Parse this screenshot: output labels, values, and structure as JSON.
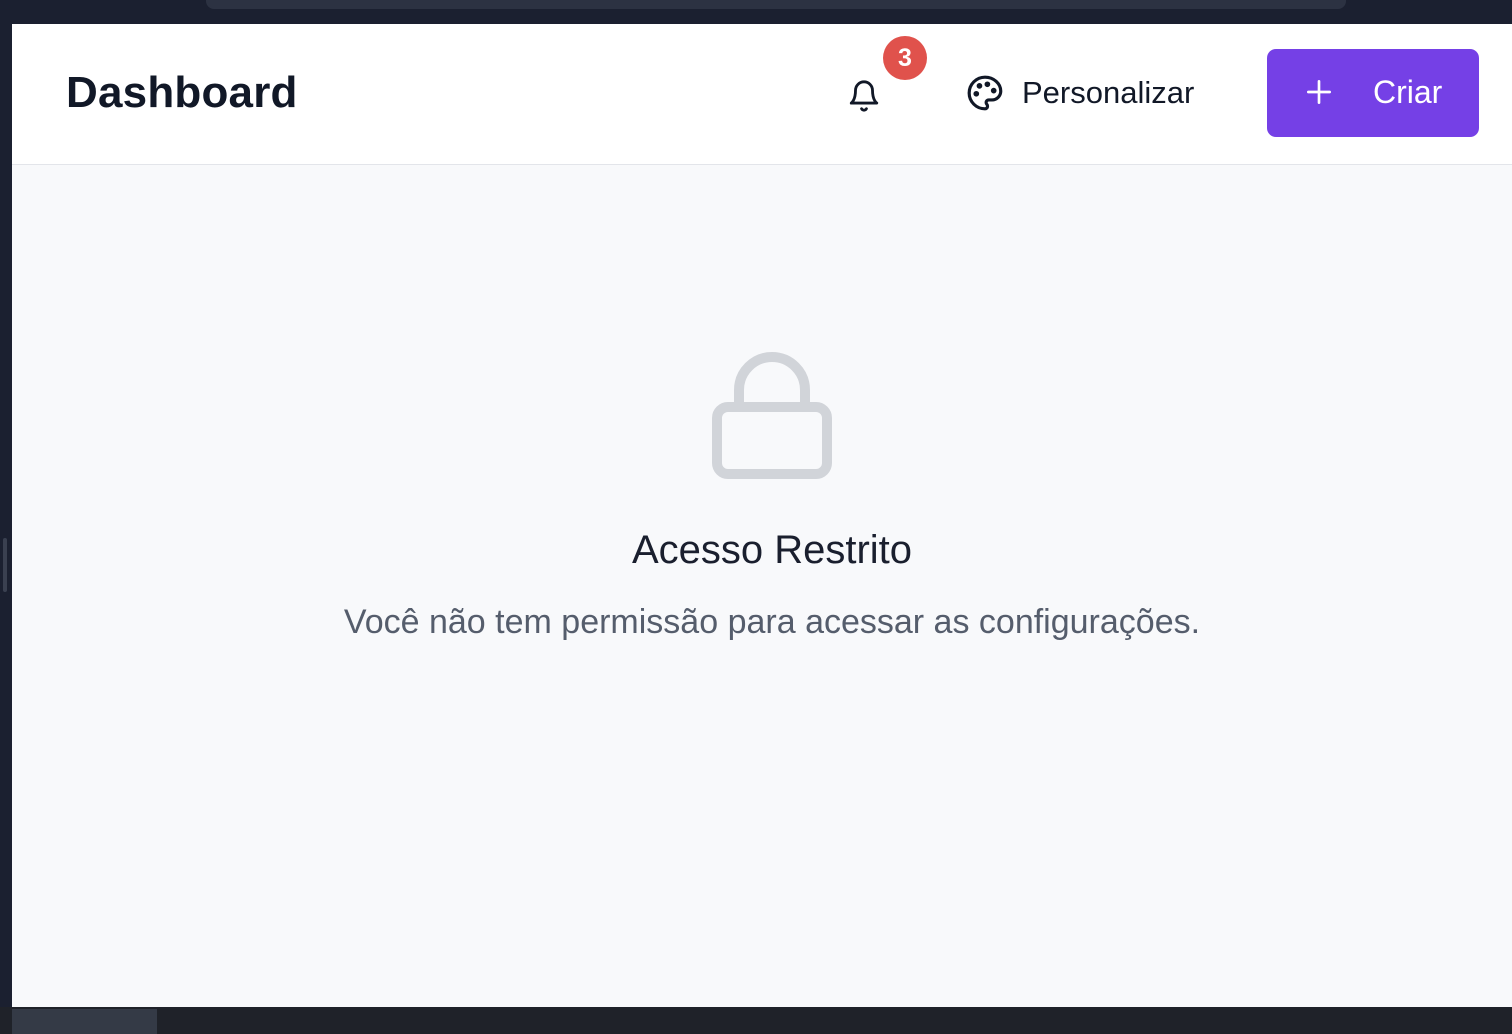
{
  "header": {
    "title": "Dashboard",
    "notifications": {
      "icon": "bell-icon",
      "count": "3"
    },
    "customize": {
      "icon": "palette-icon",
      "label": "Personalizar"
    },
    "create": {
      "icon": "plus-icon",
      "label": "Criar"
    }
  },
  "restricted": {
    "icon": "lock-icon",
    "title": "Acesso Restrito",
    "message": "Você não tem permissão para acessar as configurações."
  },
  "colors": {
    "accent": "#7540e6",
    "badge": "#e0524c",
    "background": "#f8f9fb"
  }
}
